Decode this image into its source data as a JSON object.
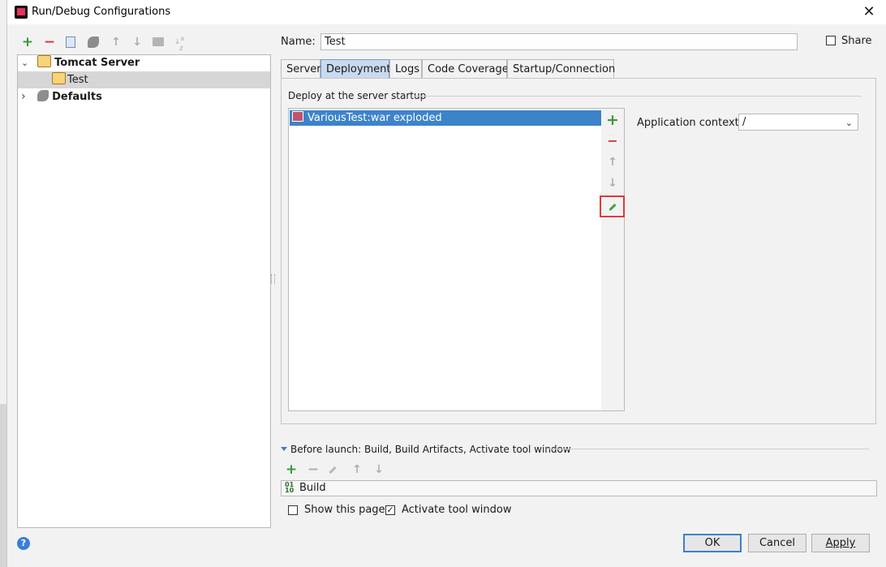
{
  "window": {
    "title": "Run/Debug Configurations",
    "close_glyph": "✕"
  },
  "toolbar": {
    "add": "+",
    "remove": "−",
    "up": "↑",
    "down": "↓"
  },
  "tree": {
    "items": [
      {
        "label": "Tomcat Server",
        "expand": "⌄",
        "bold": true
      },
      {
        "label": "Test",
        "selected": true
      },
      {
        "label": "Defaults",
        "expand": "›",
        "bold": true
      }
    ]
  },
  "name_field": {
    "label": "Name:",
    "value": "Test"
  },
  "share": {
    "label": "Share",
    "checked": false
  },
  "tabs": [
    {
      "label": "Server"
    },
    {
      "label": "Deployment",
      "active": true
    },
    {
      "label": "Logs"
    },
    {
      "label": "Code Coverage"
    },
    {
      "label": "Startup/Connection"
    }
  ],
  "deployment": {
    "section_title": "Deploy at the server startup",
    "artifacts": [
      "VariousTest:war exploded"
    ],
    "side_toolbar": {
      "add": "+",
      "remove": "−",
      "up": "↑",
      "down": "↓"
    },
    "app_context_label": "Application context:",
    "app_context_value": "/"
  },
  "before_launch": {
    "title": "Before launch: Build, Build Artifacts, Activate tool window",
    "toolbar": {
      "add": "+",
      "remove": "−",
      "up": "↑",
      "down": "↓"
    },
    "tasks": [
      "Build"
    ],
    "show_this_page": {
      "label": "Show this page",
      "checked": false
    },
    "activate_tool_window": {
      "label": "Activate tool window",
      "checked": true
    }
  },
  "buttons": {
    "ok": "OK",
    "cancel": "Cancel",
    "apply": "Apply",
    "help": "?"
  },
  "colors": {
    "selection": "#3d83c9",
    "active_tab": "#c9daf0",
    "highlight_box": "#e03a3a",
    "add_green": "#3a9a3a",
    "remove_red": "#d23b3b"
  }
}
